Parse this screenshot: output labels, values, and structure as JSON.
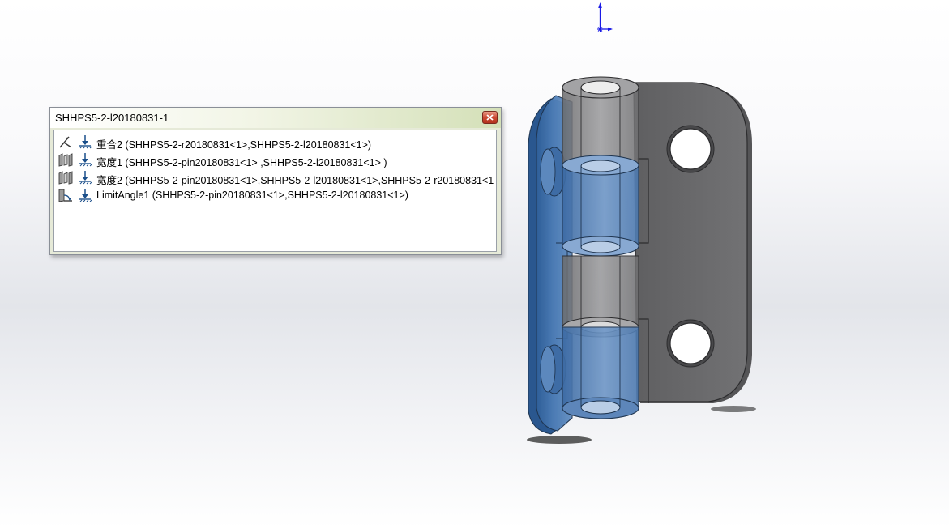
{
  "popup": {
    "title": "SHHPS5-2-l20180831-1",
    "close_icon": "close-icon",
    "mates": [
      {
        "type_icon": "coincident-mate-icon",
        "label": "重合2 (SHHPS5-2-r20180831<1>,SHHPS5-2-l20180831<1>)"
      },
      {
        "type_icon": "width-mate-icon",
        "label": "宽度1 (SHHPS5-2-pin20180831<1> ,SHHPS5-2-l20180831<1> )"
      },
      {
        "type_icon": "width-mate-icon",
        "label": "宽度2 (SHHPS5-2-pin20180831<1>,SHHPS5-2-l20180831<1>,SHHPS5-2-r20180831<1"
      },
      {
        "type_icon": "limit-angle-mate-icon",
        "label": "LimitAngle1 (SHHPS5-2-pin20180831<1>,SHHPS5-2-l20180831<1>)"
      }
    ]
  },
  "colors": {
    "popup_titlebar_accent": "#d4e0b8",
    "close_button": "#cc4b34",
    "selected_part_blue": "#4f7fb8",
    "grey_part": "#6e6e70",
    "triad_blue": "#1a1ae6"
  },
  "scene": {
    "model": "hinge-assembly",
    "triad_icon": "reference-triad-icon"
  }
}
